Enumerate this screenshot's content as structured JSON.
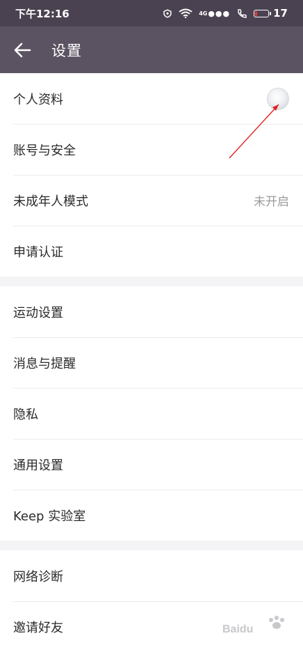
{
  "status_bar": {
    "time": "下午12:16",
    "network": "4G",
    "battery": "17"
  },
  "header": {
    "back_icon": "arrow-left-icon",
    "title": "设置"
  },
  "groups": [
    {
      "items": [
        {
          "label": "个人资料",
          "accessory": "avatar"
        },
        {
          "label": "账号与安全"
        },
        {
          "label": "未成年人模式",
          "value": "未开启"
        },
        {
          "label": "申请认证"
        }
      ]
    },
    {
      "items": [
        {
          "label": "运动设置"
        },
        {
          "label": "消息与提醒"
        },
        {
          "label": "隐私"
        },
        {
          "label": "通用设置"
        },
        {
          "label": "Keep 实验室"
        }
      ]
    },
    {
      "items": [
        {
          "label": "网络诊断"
        },
        {
          "label": "邀请好友"
        }
      ]
    }
  ],
  "colors": {
    "status_bar_bg": "#4a4250",
    "app_bar_bg": "#5b5362",
    "annotation_arrow": "#e02020"
  }
}
